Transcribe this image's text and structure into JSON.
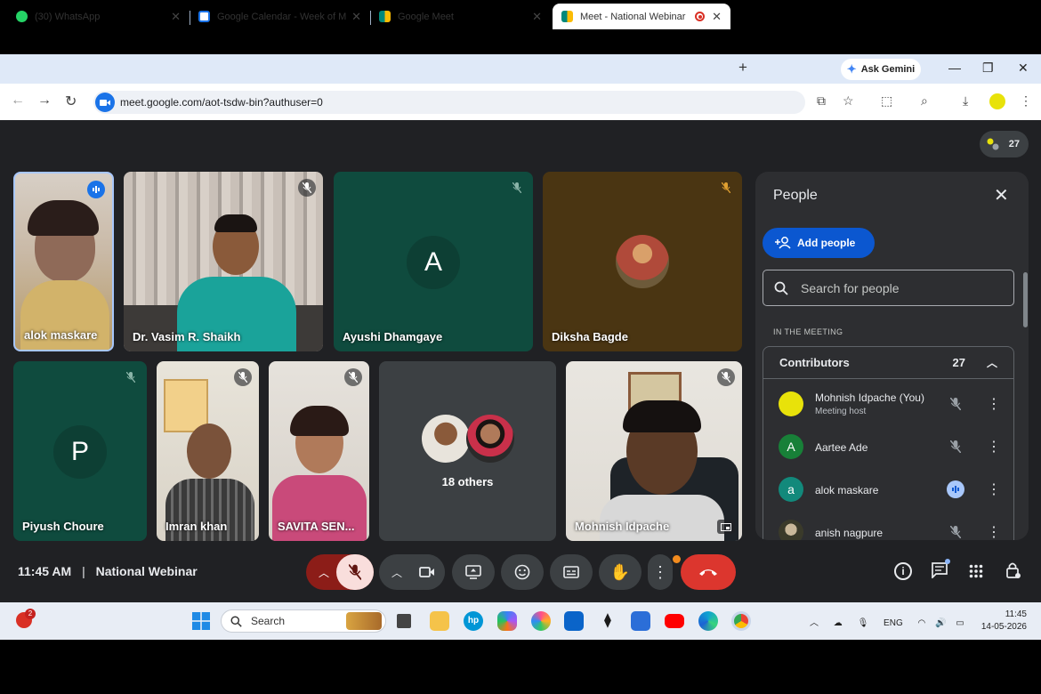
{
  "browser": {
    "tabs": [
      {
        "title": "(30) WhatsApp",
        "favicon": "whatsapp-icon",
        "color": "#25d366"
      },
      {
        "title": "Google Calendar - Week of Ma",
        "favicon": "calendar-icon",
        "color": "#1a73e8"
      },
      {
        "title": "Google Meet",
        "favicon": "meet-icon",
        "color": "#00897b"
      },
      {
        "title": "Meet - National Webinar",
        "favicon": "meet-icon",
        "color": "#00897b",
        "active": true,
        "recording": true
      }
    ],
    "ask_gemini": "Ask Gemini",
    "url": "meet.google.com/aot-tsdw-bin?authuser=0"
  },
  "meet": {
    "participant_count": "27",
    "tiles": [
      {
        "name": "alok maskare",
        "type": "video",
        "speaking": true
      },
      {
        "name": "Dr. Vasim R. Shaikh",
        "type": "video",
        "muted": true
      },
      {
        "name": "Ayushi Dhamgaye",
        "type": "avatar",
        "initial": "A",
        "muted": true
      },
      {
        "name": "Diksha Bagde",
        "type": "photo",
        "muted": true
      },
      {
        "name": "Piyush Choure",
        "type": "avatar",
        "initial": "P",
        "muted": true
      },
      {
        "name": "Imran khan",
        "type": "video",
        "muted": true
      },
      {
        "name": "SAVITA SEN...",
        "type": "video",
        "muted": true
      },
      {
        "name": "18 others",
        "type": "others"
      },
      {
        "name": "Mohnish Idpache",
        "type": "video",
        "muted": true
      }
    ],
    "time": "11:45 AM",
    "meeting_title": "National Webinar"
  },
  "people_panel": {
    "title": "People",
    "add_people": "Add people",
    "search_placeholder": "Search for people",
    "section": "IN THE MEETING",
    "group_label": "Contributors",
    "group_count": "27",
    "people": [
      {
        "name": "Mohnish Idpache (You)",
        "sub": "Meeting host",
        "avatar_color": "#e8e20a",
        "initial": "",
        "state": "muted"
      },
      {
        "name": "Aartee Ade",
        "sub": "",
        "avatar_color": "#188038",
        "initial": "A",
        "state": "muted"
      },
      {
        "name": "alok maskare",
        "sub": "",
        "avatar_color": "#12897b",
        "initial": "a",
        "state": "speaking"
      },
      {
        "name": "anish nagpure",
        "sub": "",
        "avatar_color": "#6b5b3a",
        "initial": "",
        "state": "muted"
      }
    ]
  },
  "taskbar": {
    "search_label": "Search",
    "notification_count": "2",
    "language": "ENG",
    "time": "11:45",
    "date": "14-05-2026"
  }
}
